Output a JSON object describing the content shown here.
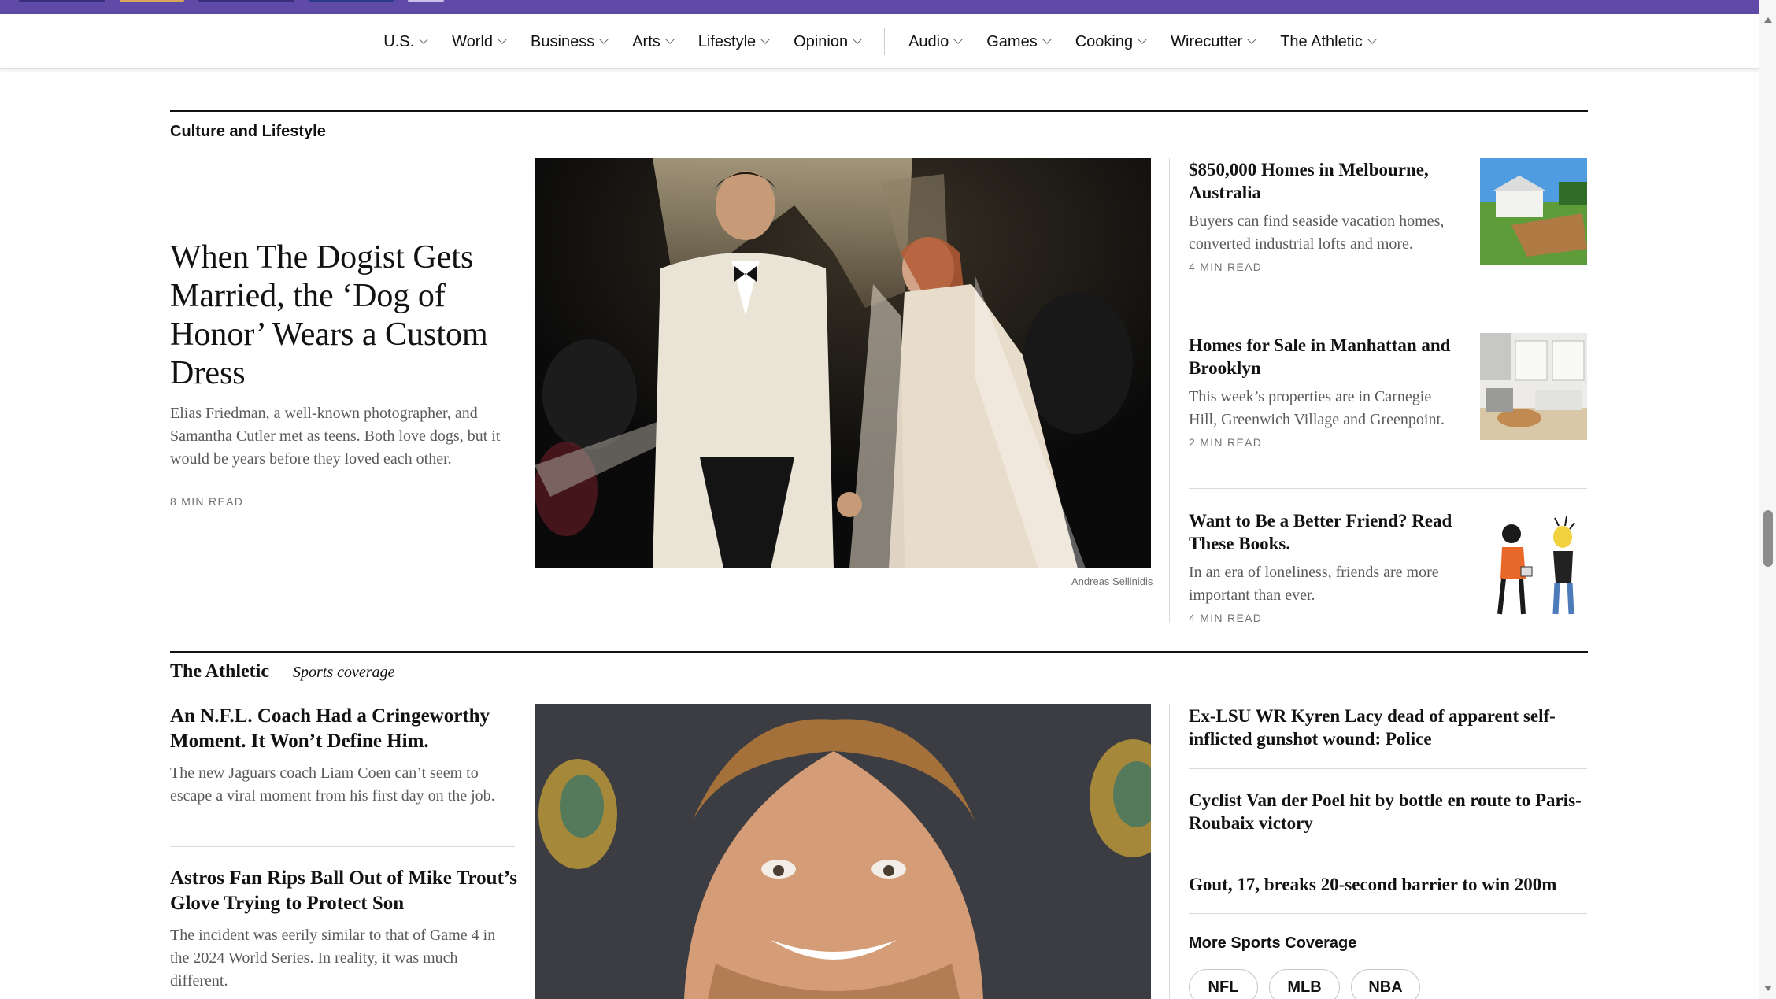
{
  "nav": {
    "items": [
      {
        "label": "U.S."
      },
      {
        "label": "World"
      },
      {
        "label": "Business"
      },
      {
        "label": "Arts"
      },
      {
        "label": "Lifestyle"
      },
      {
        "label": "Opinion"
      },
      {
        "label": "Audio"
      },
      {
        "label": "Games"
      },
      {
        "label": "Cooking"
      },
      {
        "label": "Wirecutter"
      },
      {
        "label": "The Athletic"
      }
    ]
  },
  "culture": {
    "section_label": "Culture and Lifestyle",
    "lead": {
      "headline": "When The Dogist Gets Married, the ‘Dog of Honor’ Wears a Custom Dress",
      "summary": "Elias Friedman, a well-known photographer, and Samantha Cutler met as teens. Both love dogs, but it would be years before they loved each other.",
      "read_time": "8 MIN READ",
      "photo_credit": "Andreas Sellinidis"
    },
    "side": [
      {
        "headline": "$850,000 Homes in Melbourne, Australia",
        "summary": "Buyers can find seaside vacation homes, converted industrial lofts and more.",
        "read_time": "4 MIN READ"
      },
      {
        "headline": "Homes for Sale in Manhattan and Brooklyn",
        "summary": "This week’s properties are in Carnegie Hill, Greenwich Village and Greenpoint.",
        "read_time": "2 MIN READ"
      },
      {
        "headline": "Want to Be a Better Friend? Read These Books.",
        "summary": "In an era of loneliness, friends are more important than ever.",
        "read_time": "4 MIN READ"
      }
    ]
  },
  "athletic": {
    "title": "The Athletic",
    "subtitle": "Sports coverage",
    "left": [
      {
        "headline": "An N.F.L. Coach Had a Cringeworthy Moment. It Won’t Define Him.",
        "summary": "The new Jaguars coach Liam Coen can’t seem to escape a viral moment from his first day on the job."
      },
      {
        "headline": "Astros Fan Rips Ball Out of Mike Trout’s Glove Trying to Protect Son",
        "summary": "The incident was eerily similar to that of Game 4 in the 2024 World Series. In reality, it was much different."
      }
    ],
    "right": [
      {
        "headline": "Ex-LSU WR Kyren Lacy dead of apparent self-inflicted gunshot wound: Police"
      },
      {
        "headline": "Cyclist Van der Poel hit by bottle en route to Paris-Roubaix victory"
      },
      {
        "headline": "Gout, 17, breaks 20-second barrier to win 200m"
      }
    ],
    "more_label": "More Sports Coverage",
    "pills": [
      "NFL",
      "MLB",
      "NBA"
    ]
  },
  "colors": {
    "top_strip": "#5f4aa8",
    "text": "#121212",
    "summary": "#5a5a5a",
    "divider": "#dcdcdc"
  }
}
